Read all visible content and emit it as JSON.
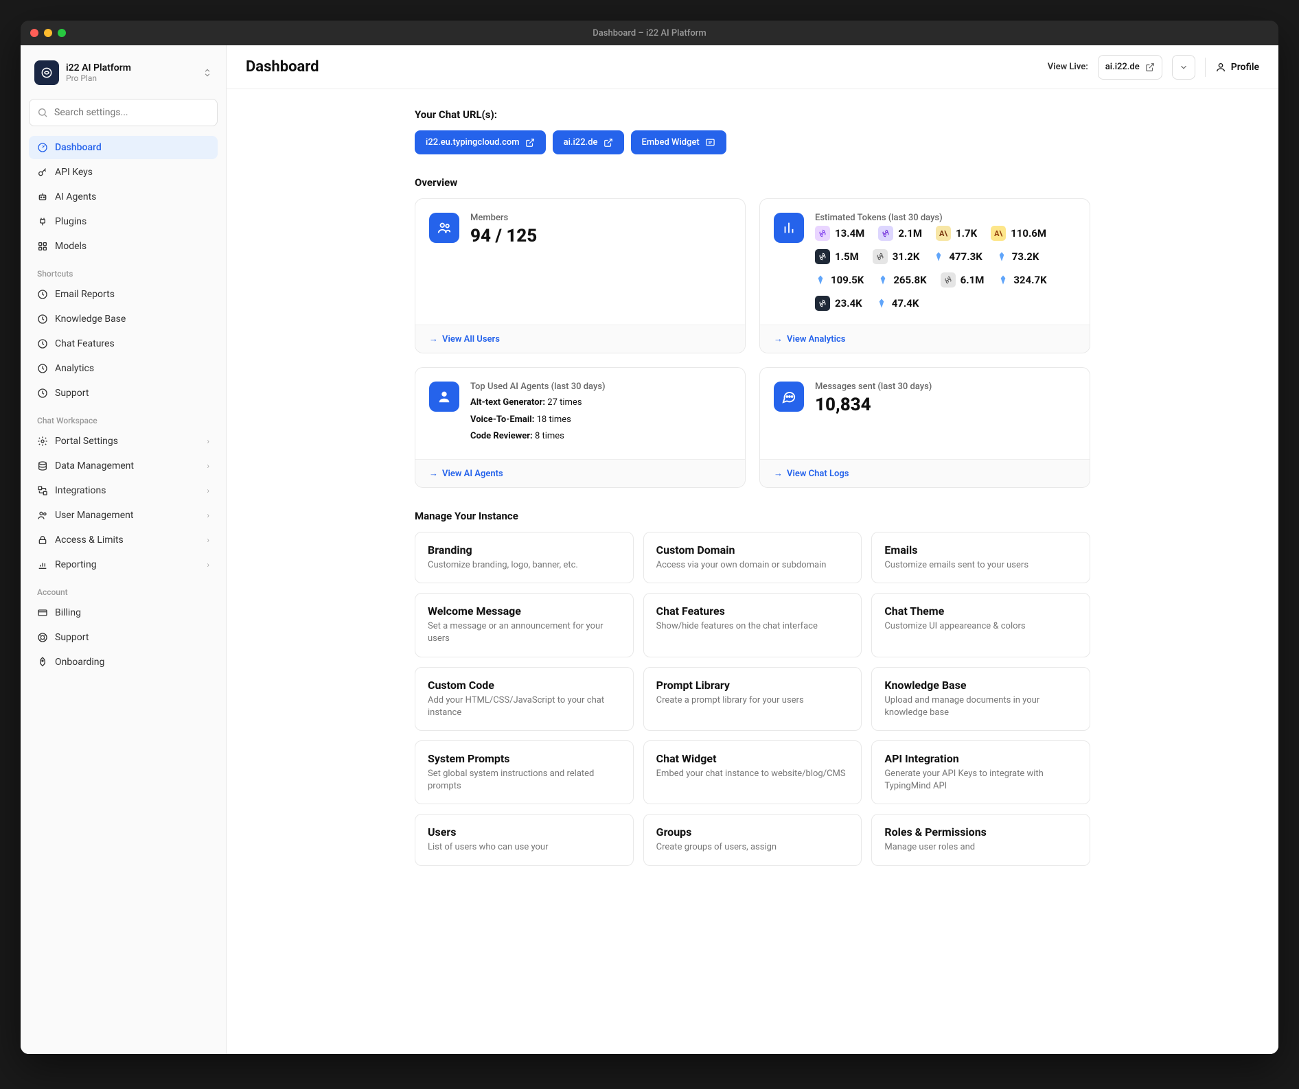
{
  "window_title": "Dashboard – i22 AI Platform",
  "org": {
    "name": "i22 AI Platform",
    "plan": "Pro Plan"
  },
  "search": {
    "placeholder": "Search settings..."
  },
  "nav_primary": [
    {
      "icon": "dashboard",
      "label": "Dashboard",
      "active": true
    },
    {
      "icon": "key",
      "label": "API Keys"
    },
    {
      "icon": "robot",
      "label": "AI Agents"
    },
    {
      "icon": "plug",
      "label": "Plugins"
    },
    {
      "icon": "model",
      "label": "Models"
    }
  ],
  "nav_sections": [
    {
      "title": "Shortcuts",
      "items": [
        {
          "icon": "clock",
          "label": "Email Reports"
        },
        {
          "icon": "clock",
          "label": "Knowledge Base"
        },
        {
          "icon": "clock",
          "label": "Chat Features"
        },
        {
          "icon": "clock",
          "label": "Analytics"
        },
        {
          "icon": "clock",
          "label": "Support"
        }
      ]
    },
    {
      "title": "Chat Workspace",
      "items": [
        {
          "icon": "settings",
          "label": "Portal Settings",
          "chevron": true
        },
        {
          "icon": "database",
          "label": "Data Management",
          "chevron": true
        },
        {
          "icon": "integrations",
          "label": "Integrations",
          "chevron": true
        },
        {
          "icon": "users",
          "label": "User Management",
          "chevron": true
        },
        {
          "icon": "lock",
          "label": "Access & Limits",
          "chevron": true
        },
        {
          "icon": "chart",
          "label": "Reporting",
          "chevron": true
        }
      ]
    },
    {
      "title": "Account",
      "items": [
        {
          "icon": "card",
          "label": "Billing"
        },
        {
          "icon": "life-ring",
          "label": "Support"
        },
        {
          "icon": "rocket",
          "label": "Onboarding"
        }
      ]
    }
  ],
  "header": {
    "title": "Dashboard",
    "view_live_label": "View Live:",
    "live_url": "ai.i22.de",
    "profile_label": "Profile"
  },
  "chat_urls": {
    "title": "Your Chat URL(s):",
    "buttons": [
      {
        "label": "i22.eu.typingcloud.com",
        "icon": "external"
      },
      {
        "label": "ai.i22.de",
        "icon": "external"
      },
      {
        "label": "Embed Widget",
        "icon": "widget"
      }
    ]
  },
  "overview": {
    "title": "Overview",
    "members": {
      "label": "Members",
      "value": "94 / 125",
      "footer": "View All Users"
    },
    "tokens": {
      "label": "Estimated Tokens (last 30 days)",
      "items": [
        {
          "badge": "openai",
          "value": "13.4M"
        },
        {
          "badge": "openai-purple",
          "value": "2.1M"
        },
        {
          "badge": "anthropic",
          "value": "1.7K"
        },
        {
          "badge": "anthropic2",
          "value": "110.6M"
        },
        {
          "badge": "openai-dark",
          "value": "1.5M"
        },
        {
          "badge": "grey",
          "value": "31.2K"
        },
        {
          "badge": "gem",
          "value": "477.3K"
        },
        {
          "badge": "gem",
          "value": "73.2K"
        },
        {
          "badge": "gem",
          "value": "109.5K"
        },
        {
          "badge": "gem",
          "value": "265.8K"
        },
        {
          "badge": "grey",
          "value": "6.1M"
        },
        {
          "badge": "gem",
          "value": "324.7K"
        },
        {
          "badge": "openai-dark",
          "value": "23.4K"
        },
        {
          "badge": "gem",
          "value": "47.4K"
        }
      ],
      "footer": "View Analytics"
    },
    "agents": {
      "label": "Top Used AI Agents (last 30 days)",
      "rows": [
        {
          "name": "Alt-text Generator:",
          "count": "27 times"
        },
        {
          "name": "Voice-To-Email:",
          "count": "18 times"
        },
        {
          "name": "Code Reviewer:",
          "count": "8 times"
        }
      ],
      "footer": "View AI Agents"
    },
    "messages": {
      "label": "Messages sent (last 30 days)",
      "value": "10,834",
      "footer": "View Chat Logs"
    }
  },
  "manage": {
    "title": "Manage Your Instance",
    "cards": [
      {
        "title": "Branding",
        "desc": "Customize branding, logo, banner, etc."
      },
      {
        "title": "Custom Domain",
        "desc": "Access via your own domain or subdomain"
      },
      {
        "title": "Emails",
        "desc": "Customize emails sent to your users"
      },
      {
        "title": "Welcome Message",
        "desc": "Set a message or an announcement for your users"
      },
      {
        "title": "Chat Features",
        "desc": "Show/hide features on the chat interface"
      },
      {
        "title": "Chat Theme",
        "desc": "Customize UI appeareance & colors"
      },
      {
        "title": "Custom Code",
        "desc": "Add your HTML/CSS/JavaScript to your chat instance"
      },
      {
        "title": "Prompt Library",
        "desc": "Create a prompt library for your users"
      },
      {
        "title": "Knowledge Base",
        "desc": "Upload and manage documents in your knowledge base"
      },
      {
        "title": "System Prompts",
        "desc": "Set global system instructions and related prompts"
      },
      {
        "title": "Chat Widget",
        "desc": "Embed your chat instance to website/blog/CMS"
      },
      {
        "title": "API Integration",
        "desc": "Generate your API Keys to integrate with TypingMind API"
      },
      {
        "title": "Users",
        "desc": "List of users who can use your"
      },
      {
        "title": "Groups",
        "desc": "Create groups of users, assign"
      },
      {
        "title": "Roles & Permissions",
        "desc": "Manage user roles and"
      }
    ]
  }
}
